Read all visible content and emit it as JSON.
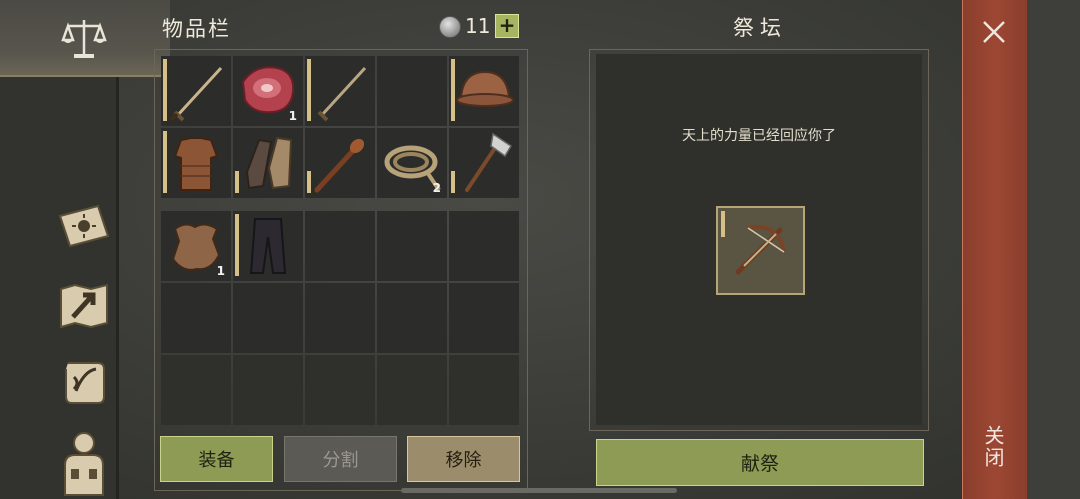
{
  "inventory": {
    "title": "物品栏",
    "coins": "11",
    "plus_label": "+",
    "rows1": [
      [
        {
          "icon": "sword-icon",
          "qty": ""
        },
        {
          "icon": "raw-meat-icon",
          "qty": "1"
        },
        {
          "icon": "sword-icon",
          "qty": ""
        },
        {
          "icon": "",
          "qty": ""
        },
        {
          "icon": "helmet-icon",
          "qty": ""
        }
      ],
      [
        {
          "icon": "leather-armor-icon",
          "qty": ""
        },
        {
          "icon": "gloves-icon",
          "qty": ""
        },
        {
          "icon": "club-icon",
          "qty": ""
        },
        {
          "icon": "rope-icon",
          "qty": "2"
        },
        {
          "icon": "hatchet-icon",
          "qty": ""
        }
      ]
    ],
    "rows2": [
      [
        {
          "icon": "leather-hide-icon",
          "qty": "1"
        },
        {
          "icon": "pants-icon",
          "qty": ""
        },
        {
          "icon": "",
          "qty": ""
        },
        {
          "icon": "",
          "qty": ""
        },
        {
          "icon": "",
          "qty": ""
        }
      ]
    ],
    "buttons": {
      "equip": "装备",
      "split": "分割",
      "remove": "移除"
    }
  },
  "altar": {
    "title": "祭坛",
    "message": "天上的力量已经回应你了",
    "slot_icon": "crossbow-icon",
    "offer_button": "献祭"
  },
  "close": {
    "label": "关闭"
  },
  "sidebar": {
    "icons": [
      "scales-icon",
      "journal-sun-icon",
      "map-arrow-icon",
      "quest-scroll-icon",
      "character-icon"
    ]
  }
}
